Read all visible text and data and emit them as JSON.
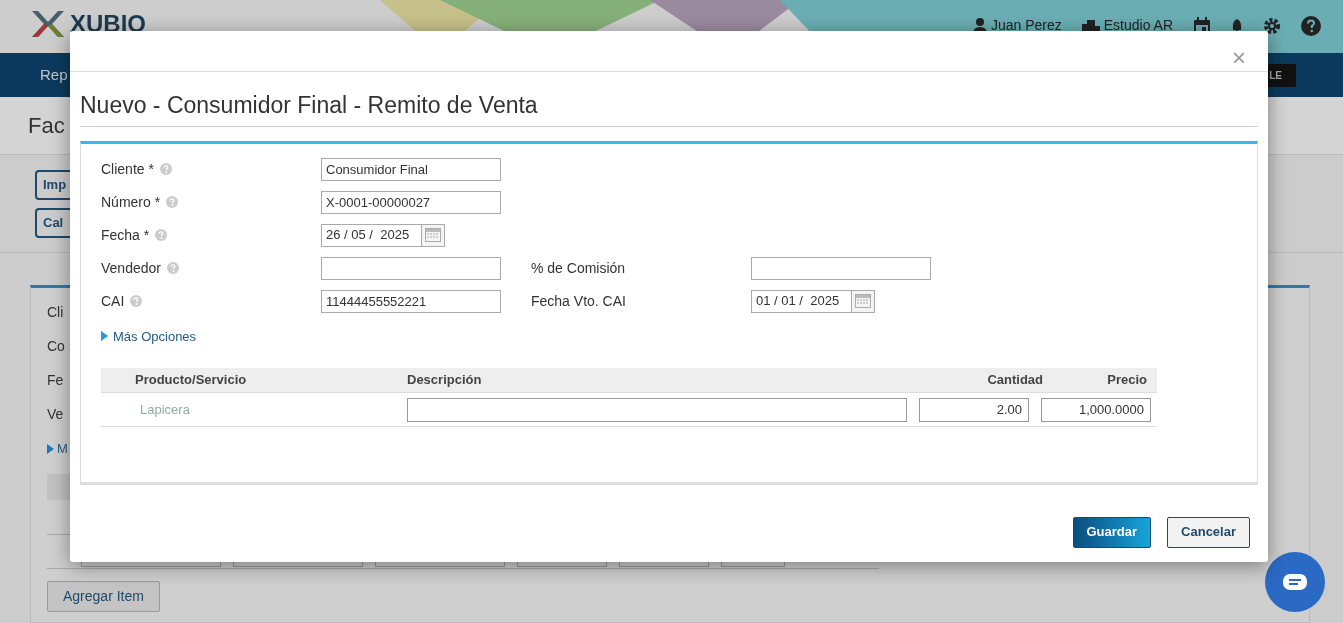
{
  "background": {
    "logo": "XUBIO",
    "user": "Juan Perez",
    "company": "Estudio AR",
    "nav_item": "Rep",
    "nav_button": "LE",
    "page_title": "Fac",
    "buttons": [
      "Imp",
      "Cal"
    ],
    "form_labels": [
      "Cli",
      "Co",
      "Fe",
      "Ve"
    ],
    "more_options": "M",
    "add_item": "Agregar Item"
  },
  "dialog": {
    "title": "Nuevo - Consumidor Final - Remito de Venta",
    "close": "×",
    "rows": [
      {
        "fields": [
          {
            "label": "Cliente *",
            "help": true,
            "kind": "text",
            "value": "Consumidor Final"
          }
        ]
      },
      {
        "fields": [
          {
            "label": "Número *",
            "help": true,
            "kind": "text",
            "value": "X-0001-00000027"
          }
        ]
      },
      {
        "fields": [
          {
            "label": "Fecha *",
            "help": true,
            "kind": "date",
            "value": "26 / 05 /  2025"
          }
        ]
      },
      {
        "fields": [
          {
            "label": "Vendedor",
            "help": true,
            "kind": "text"
          },
          {
            "label": "% de Comisión",
            "help": false,
            "kind": "text"
          }
        ]
      },
      {
        "fields": [
          {
            "label": "CAI",
            "help": true,
            "kind": "text",
            "value": "11444455552221"
          },
          {
            "label": "Fecha Vto. CAI",
            "help": false,
            "kind": "date",
            "value": "01 / 01 /  2025"
          }
        ]
      }
    ],
    "more_options": {
      "label": "Más Opciones",
      "expanded": false
    },
    "table": {
      "columns": [
        "Producto/Servicio",
        "Descripción",
        "Cantidad",
        "Precio"
      ],
      "rows": [
        {
          "product": "Lapicera",
          "quantity": "2.00",
          "price": "1,000.0000"
        }
      ]
    },
    "buttons": [
      {
        "label": "Guardar",
        "kind": "primary"
      },
      {
        "label": "Cancelar",
        "kind": "secondary"
      }
    ]
  }
}
